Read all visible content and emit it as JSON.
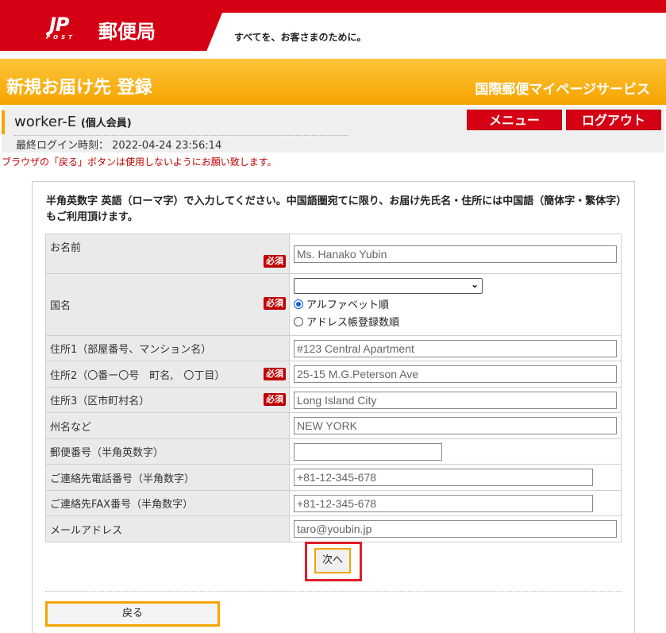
{
  "header": {
    "logo_mark": "JP",
    "logo_post": "POST",
    "logo_name": "郵便局",
    "tagline": "すべてを、お客さまのために。",
    "page_title": "新規お届け先 登録",
    "service_name": "国際郵便マイページサービス"
  },
  "user": {
    "name": "worker-E",
    "type": "(個人会員)",
    "last_login_label": "最終ログイン時刻：",
    "last_login_value": "2022-04-24 23:56:14",
    "menu_label": "メニュー",
    "logout_label": "ログアウト"
  },
  "warning": "ブラウザの「戻る」ボタンは使用しないようにお願い致します。",
  "intro": "半角英数字 英語（ローマ字）で入力してください。中国語圏宛てに限り、お届け先氏名・住所には中国語（簡体字・繁体字）もご利用頂けます。",
  "required_badge": "必須",
  "fields": {
    "name": {
      "label": "お名前",
      "value": "Ms. Hanako Yubin"
    },
    "country": {
      "label": "国名",
      "value": "",
      "sort_alpha": "アルファベット順",
      "sort_count": "アドレス帳登録数順"
    },
    "address1": {
      "label": "住所1（部屋番号、マンション名）",
      "value": "#123 Central Apartment"
    },
    "address2": {
      "label": "住所2（〇番ー〇号　町名,　〇丁目）",
      "value": "25-15 M.G.Peterson Ave"
    },
    "address3": {
      "label": "住所3（区市町村名）",
      "value": "Long Island City"
    },
    "state": {
      "label": "州名など",
      "value": "NEW YORK"
    },
    "postal": {
      "label": "郵便番号（半角英数字）",
      "value": ""
    },
    "phone": {
      "label": "ご連絡先電話番号（半角数字）",
      "value": "+81-12-345-678"
    },
    "fax": {
      "label": "ご連絡先FAX番号（半角数字）",
      "value": "+81-12-345-678"
    },
    "email": {
      "label": "メールアドレス",
      "value": "taro@youbin.jp"
    }
  },
  "buttons": {
    "next": "次へ",
    "back": "戻る"
  },
  "colors": {
    "brand_red": "#d60014",
    "accent_orange": "#f6a400",
    "highlight_red": "#e01f26"
  }
}
